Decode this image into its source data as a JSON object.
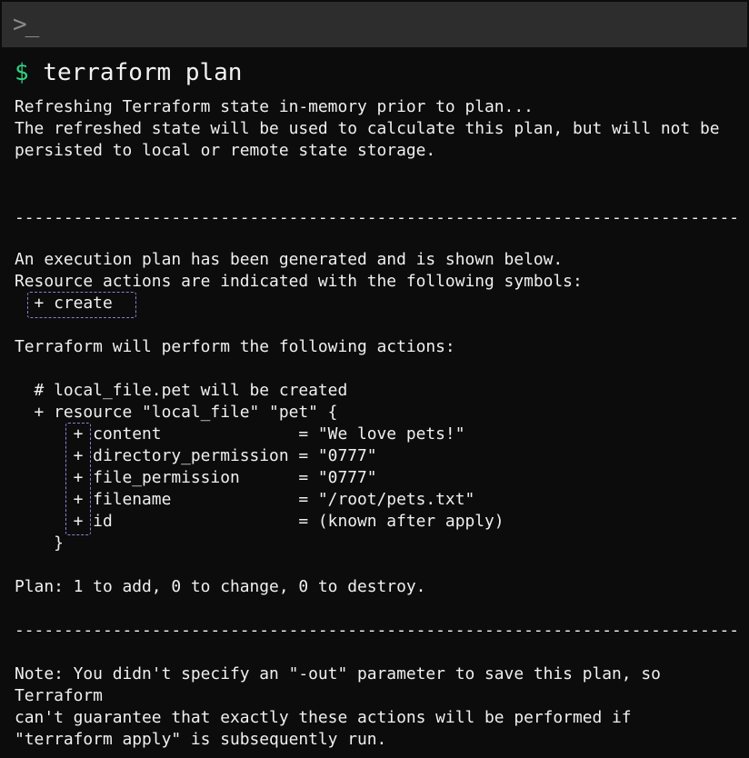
{
  "window": {
    "title_icon": ">_"
  },
  "command": {
    "prompt": "$",
    "text": " terraform plan"
  },
  "output": {
    "lines": [
      "Refreshing Terraform state in-memory prior to plan...",
      "The refreshed state will be used to calculate this plan, but will not be",
      "persisted to local or remote state storage.",
      "--------------------------------------------------------------------------",
      "An execution plan has been generated and is shown below.",
      "Resource actions are indicated with the following symbols:",
      "  + create",
      "Terraform will perform the following actions:",
      "  # local_file.pet will be created",
      "  + resource \"local_file\" \"pet\" {",
      "      + content              = \"We love pets!\"",
      "      + directory_permission = \"0777\"",
      "      + file_permission      = \"0777\"",
      "      + filename             = \"/root/pets.txt\"",
      "      + id                   = (known after apply)",
      "    }",
      "Plan: 1 to add, 0 to change, 0 to destroy.",
      "--------------------------------------------------------------------------",
      "Note: You didn't specify an \"-out\" parameter to save this plan, so",
      "Terraform",
      "can't guarantee that exactly these actions will be performed if",
      "\"terraform apply\" is subsequently run."
    ]
  },
  "colors": {
    "background": "#0c0c0c",
    "titlebar": "#2d2d2d",
    "prompt": "#2fd180",
    "text": "#f2f2f2",
    "highlight": "#8b7fd6"
  }
}
